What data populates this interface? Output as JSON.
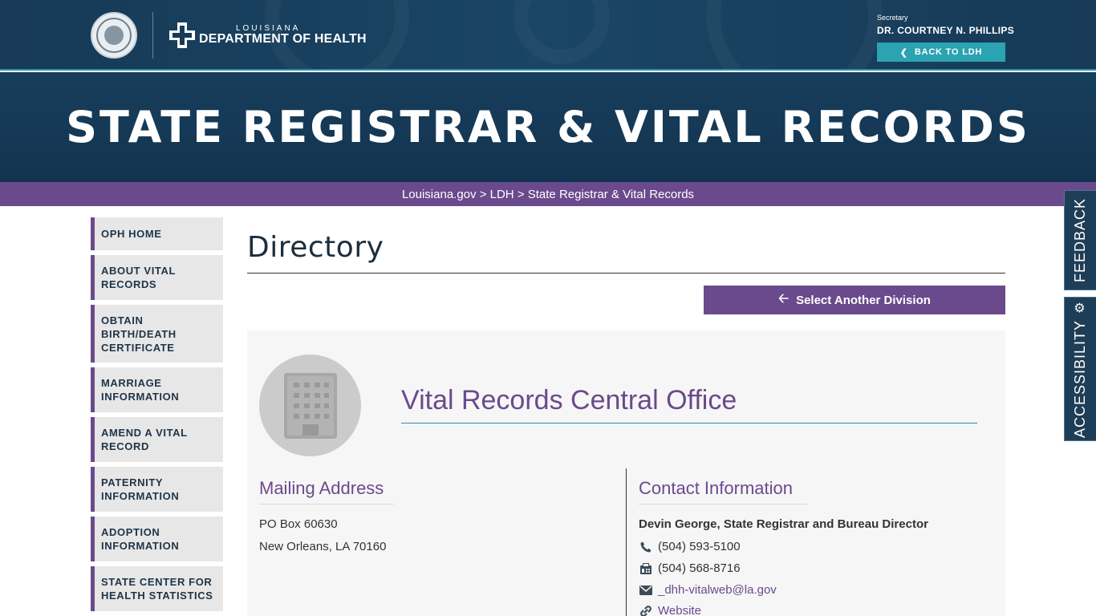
{
  "header": {
    "logo_small": "LOUISIANA",
    "logo_big": "DEPARTMENT OF HEALTH",
    "secretary_role": "Secretary",
    "secretary_name": "DR. COURTNEY N. PHILLIPS",
    "back_label": "BACK TO LDH"
  },
  "hero": {
    "title": "STATE REGISTRAR & VITAL RECORDS"
  },
  "breadcrumb": {
    "items": [
      "Louisiana.gov",
      "LDH",
      "State Registrar & Vital Records"
    ],
    "separator": ">"
  },
  "sidebar": {
    "items": [
      {
        "label": "OPH HOME"
      },
      {
        "label": "ABOUT VITAL RECORDS"
      },
      {
        "label": "OBTAIN BIRTH/DEATH CERTIFICATE"
      },
      {
        "label": "MARRIAGE INFORMATION"
      },
      {
        "label": "AMEND A VITAL RECORD"
      },
      {
        "label": "PATERNITY INFORMATION"
      },
      {
        "label": "ADOPTION INFORMATION"
      },
      {
        "label": "STATE CENTER FOR HEALTH STATISTICS"
      }
    ]
  },
  "main": {
    "page_title": "Directory",
    "select_label": "Select Another Division",
    "office": {
      "name": "Vital Records Central Office",
      "mailing_title": "Mailing Address",
      "address_line1": "PO Box 60630",
      "address_line2": "New Orleans, LA 70160",
      "contact_title": "Contact Information",
      "contact_name": "Devin George, State Registrar and Bureau Director",
      "phone": "(504) 593-5100",
      "fax": "(504) 568-8716",
      "email": "_dhh-vitalweb@la.gov",
      "website": "Website"
    }
  },
  "side_tabs": {
    "feedback": "FEEDBACK",
    "accessibility": "ACCESSIBILITY"
  },
  "icons": {
    "phone": "phone-icon",
    "fax": "fax-icon",
    "email": "envelope-icon",
    "website": "link-icon",
    "building": "building-icon",
    "gear": "gear-icon"
  },
  "colors": {
    "navy": "#163a57",
    "teal": "#2ba3b0",
    "purple": "#6a4a8d",
    "sidebar_bg": "#e7e7e7",
    "card_bg": "#f6f6f6"
  }
}
